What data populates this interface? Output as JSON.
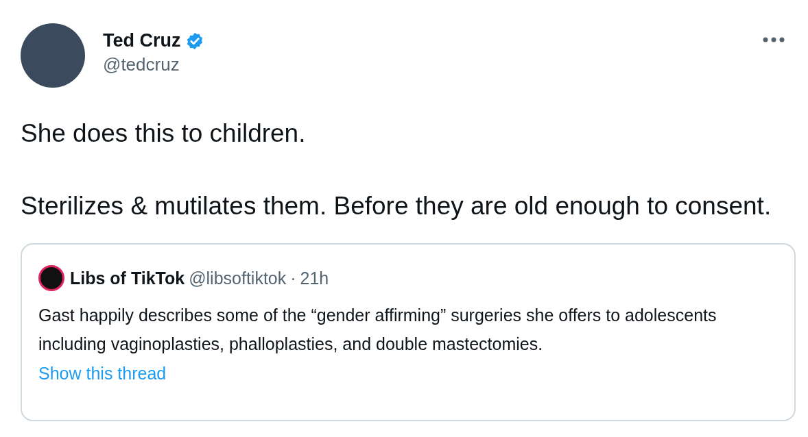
{
  "author": {
    "name": "Ted Cruz",
    "handle": "@tedcruz",
    "verified": true
  },
  "tweet": {
    "paragraphs": [
      "She does this to children.",
      "Sterilizes & mutilates them. Before they are old enough to consent."
    ]
  },
  "quote": {
    "name": "Libs of TikTok",
    "handle": "@libsoftiktok",
    "separator": "·",
    "time": "21h",
    "text": "Gast happily describes some of the “gender affirming” surgeries she offers to adolescents including vaginoplasties, phalloplasties, and double mastectomies.",
    "link": "Show this thread"
  }
}
